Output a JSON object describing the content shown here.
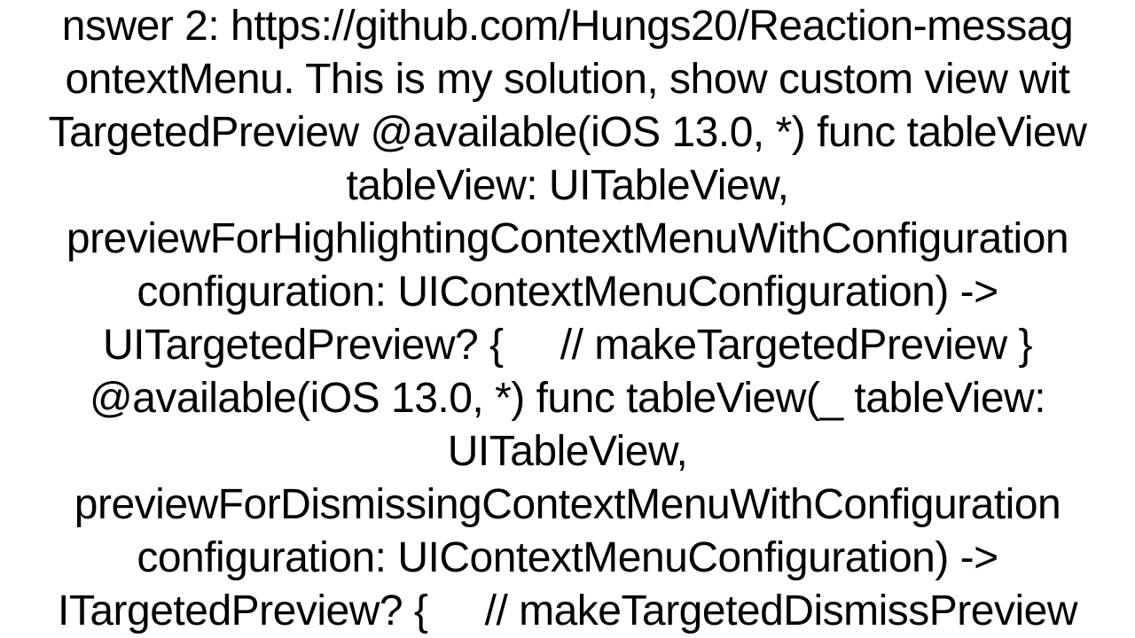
{
  "text": {
    "body": "nswer 2: https://github.com/Hungs20/Reaction-messag\nontextMenu. This is my solution, show custom view wit\nTargetedPreview @available(iOS 13.0, *) func tableView\ntableView: UITableView,\npreviewForHighlightingContextMenuWithConfiguration\nconfiguration: UIContextMenuConfiguration) ->\nUITargetedPreview? {     // makeTargetedPreview }\n@available(iOS 13.0, *) func tableView(_ tableView:\nUITableView,\npreviewForDismissingContextMenuWithConfiguration\nconfiguration: UIContextMenuConfiguration) ->\nITargetedPreview? {     // makeTargetedDismissPreview"
  }
}
